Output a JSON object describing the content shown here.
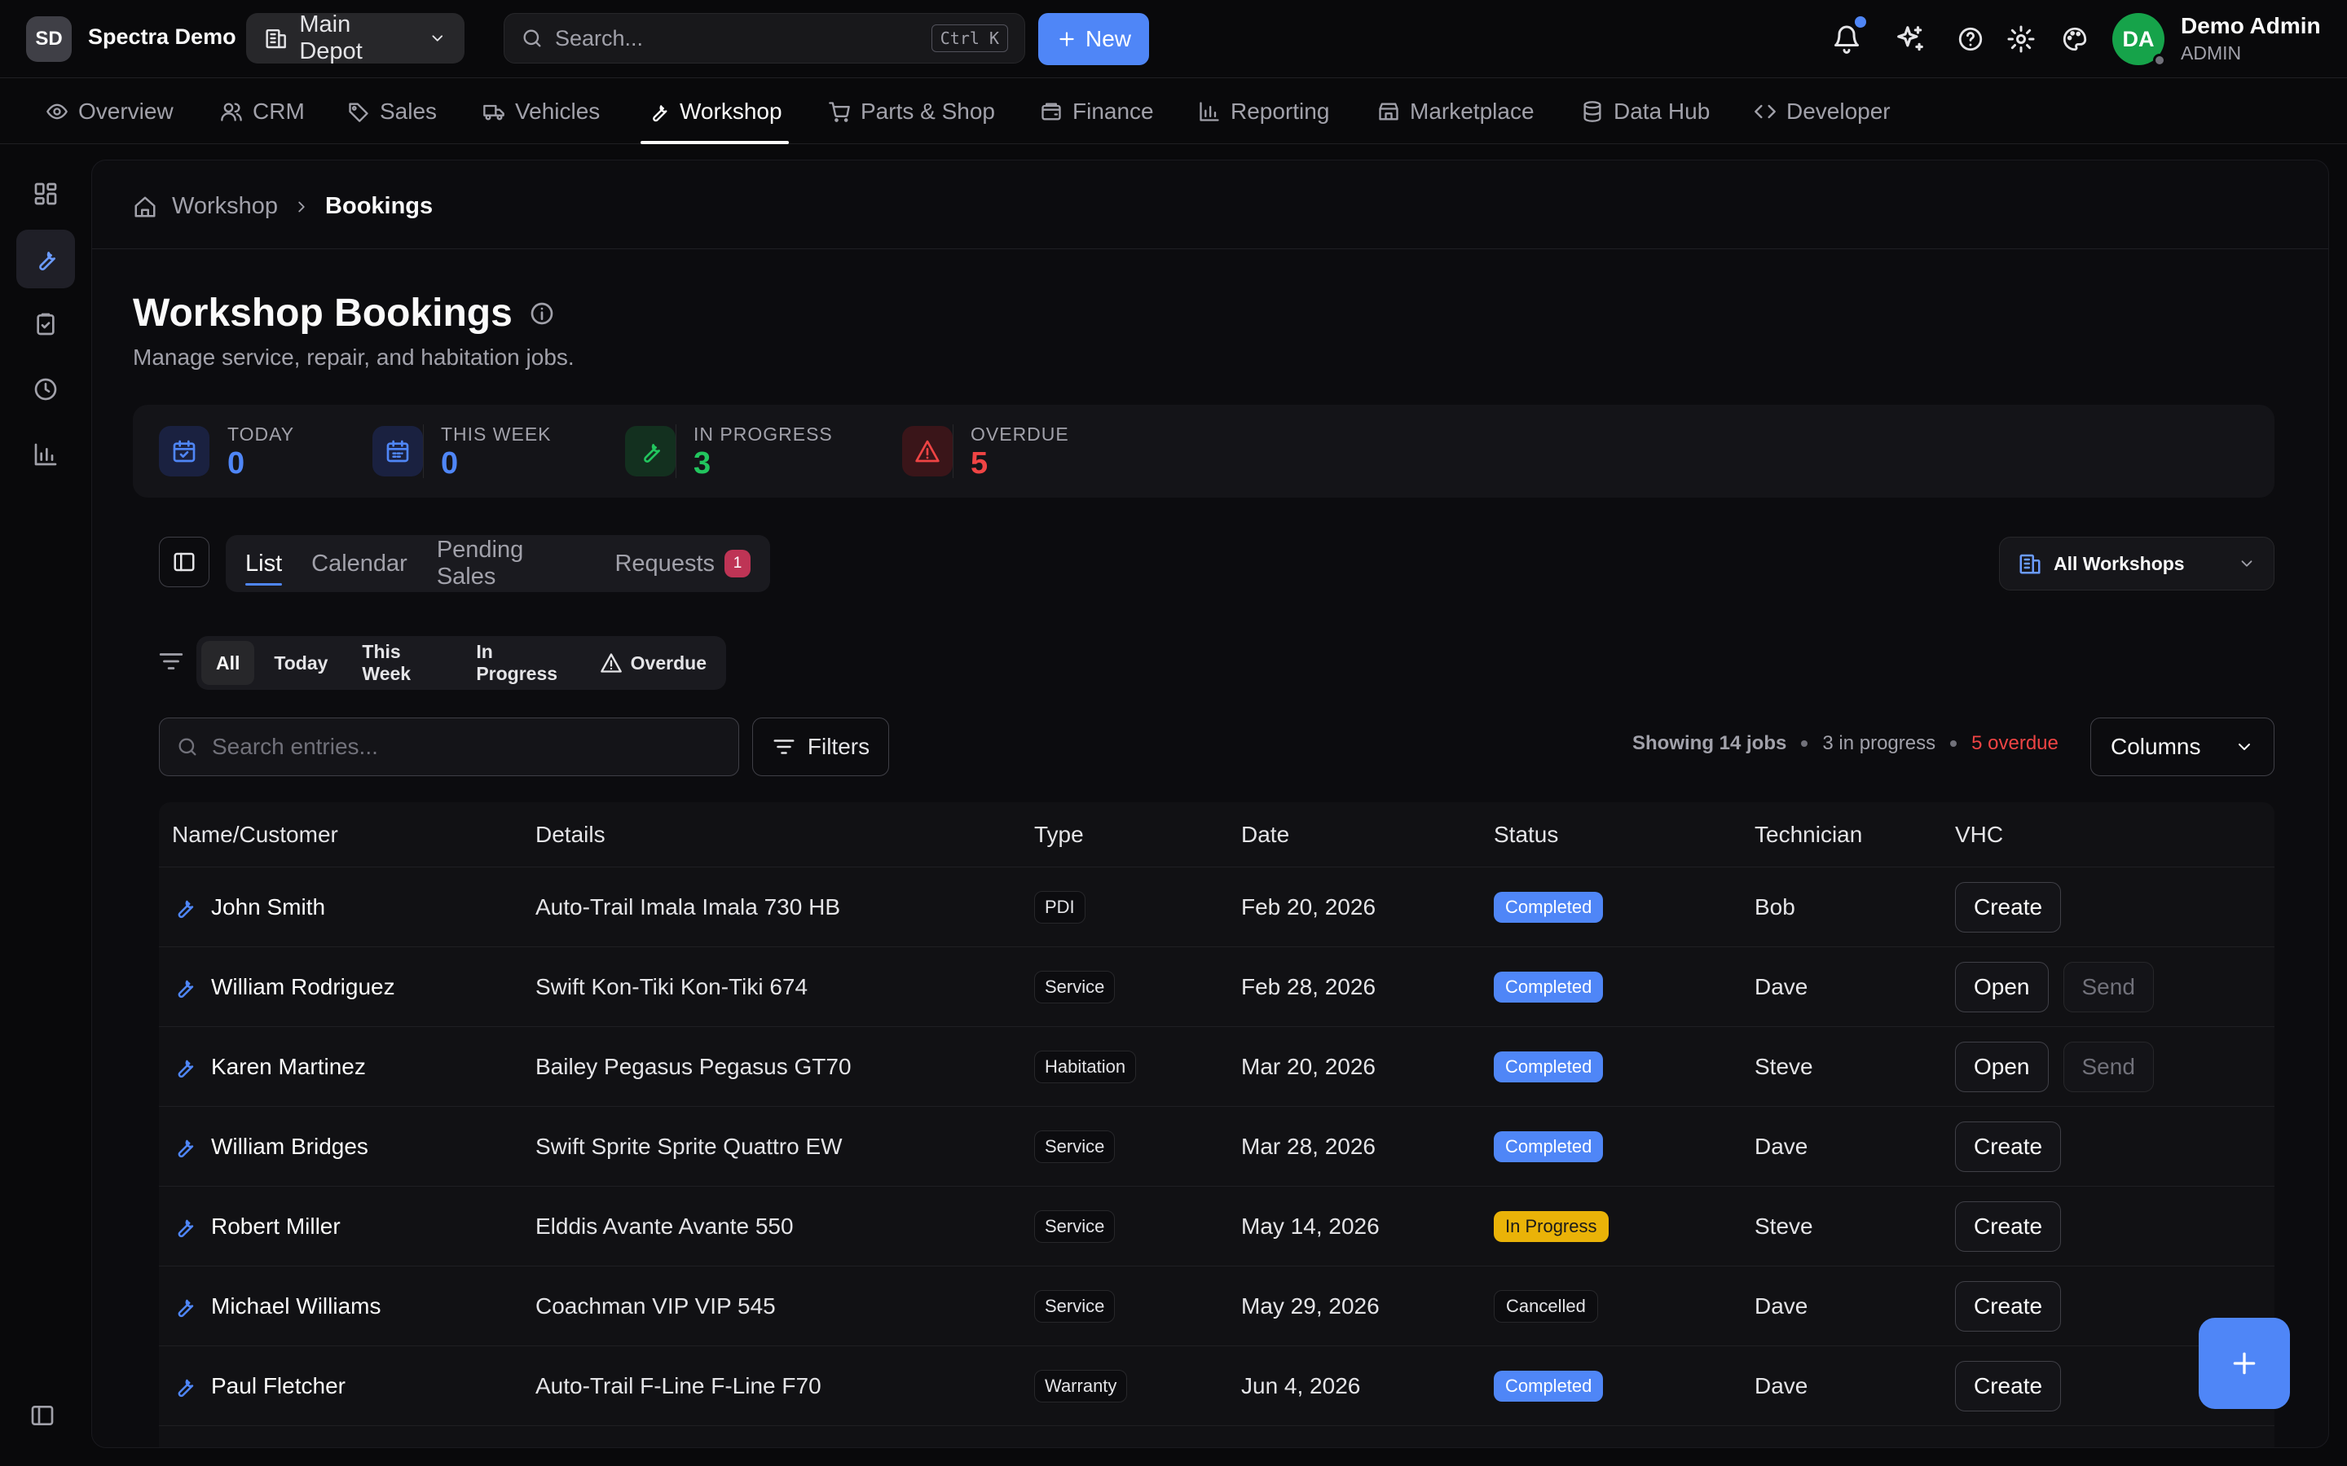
{
  "org": {
    "initials": "SD",
    "name": "Spectra Demo"
  },
  "depot": {
    "label": "Main Depot"
  },
  "global_search": {
    "placeholder": "Search...",
    "shortcut": "Ctrl K"
  },
  "new_button": {
    "label": "New"
  },
  "user": {
    "initials": "DA",
    "name": "Demo Admin",
    "role": "ADMIN"
  },
  "nav": {
    "items": [
      {
        "label": "Overview",
        "icon": "eye-icon"
      },
      {
        "label": "CRM",
        "icon": "users-icon"
      },
      {
        "label": "Sales",
        "icon": "tag-icon"
      },
      {
        "label": "Vehicles",
        "icon": "truck-icon"
      },
      {
        "label": "Workshop",
        "icon": "wrench-icon",
        "active": true
      },
      {
        "label": "Parts & Shop",
        "icon": "cart-icon"
      },
      {
        "label": "Finance",
        "icon": "wallet-icon"
      },
      {
        "label": "Reporting",
        "icon": "bar-chart-icon"
      },
      {
        "label": "Marketplace",
        "icon": "store-icon"
      },
      {
        "label": "Data Hub",
        "icon": "database-icon"
      },
      {
        "label": "Developer",
        "icon": "code-icon"
      }
    ]
  },
  "breadcrumb": {
    "parent": "Workshop",
    "current": "Bookings"
  },
  "page": {
    "title": "Workshop Bookings",
    "subtitle": "Manage service, repair, and habitation jobs."
  },
  "stats": [
    {
      "label": "TODAY",
      "value": "0",
      "color": "#4f86f7"
    },
    {
      "label": "THIS WEEK",
      "value": "0",
      "color": "#4f86f7"
    },
    {
      "label": "IN PROGRESS",
      "value": "3",
      "color": "#22c55e"
    },
    {
      "label": "OVERDUE",
      "value": "5",
      "color": "#ef4444"
    }
  ],
  "view_tabs": [
    {
      "label": "List",
      "active": true
    },
    {
      "label": "Calendar"
    },
    {
      "label": "Pending Sales"
    },
    {
      "label": "Requests",
      "badge": "1"
    }
  ],
  "workshop_select": {
    "label": "All Workshops"
  },
  "quick_filters": [
    {
      "label": "All",
      "active": true
    },
    {
      "label": "Today"
    },
    {
      "label": "This Week"
    },
    {
      "label": "In Progress"
    },
    {
      "label": "Overdue",
      "icon": "alert-triangle-icon"
    }
  ],
  "table_search": {
    "placeholder": "Search entries..."
  },
  "filters_button": {
    "label": "Filters"
  },
  "summary": {
    "showing": "Showing 14 jobs",
    "in_progress": "3 in progress",
    "overdue": "5 overdue"
  },
  "columns_button": {
    "label": "Columns"
  },
  "table": {
    "headers": [
      "Name/Customer",
      "Details",
      "Type",
      "Date",
      "Status",
      "Technician",
      "VHC"
    ],
    "rows": [
      {
        "name": "John Smith",
        "details": "Auto-Trail Imala Imala 730 HB",
        "type": "PDI",
        "date": "Feb 20, 2026",
        "status": "Completed",
        "technician": "Bob",
        "vhc": [
          "Create"
        ]
      },
      {
        "name": "William Rodriguez",
        "details": "Swift Kon-Tiki Kon-Tiki 674",
        "type": "Service",
        "date": "Feb 28, 2026",
        "status": "Completed",
        "technician": "Dave",
        "vhc": [
          "Open",
          "Send"
        ]
      },
      {
        "name": "Karen Martinez",
        "details": "Bailey Pegasus Pegasus GT70",
        "type": "Habitation",
        "date": "Mar 20, 2026",
        "status": "Completed",
        "technician": "Steve",
        "vhc": [
          "Open",
          "Send"
        ]
      },
      {
        "name": "William Bridges",
        "details": "Swift Sprite Sprite Quattro EW",
        "type": "Service",
        "date": "Mar 28, 2026",
        "status": "Completed",
        "technician": "Dave",
        "vhc": [
          "Create"
        ]
      },
      {
        "name": "Robert Miller",
        "details": "Elddis Avante Avante 550",
        "type": "Service",
        "date": "May 14, 2026",
        "status": "In Progress",
        "technician": "Steve",
        "vhc": [
          "Create"
        ]
      },
      {
        "name": "Michael Williams",
        "details": "Coachman VIP VIP 545",
        "type": "Service",
        "date": "May 29, 2026",
        "status": "Cancelled",
        "technician": "Dave",
        "vhc": [
          "Create"
        ]
      },
      {
        "name": "Paul Fletcher",
        "details": "Auto-Trail F-Line F-Line F70",
        "type": "Warranty",
        "date": "Jun 4, 2026",
        "status": "Completed",
        "technician": "Dave",
        "vhc": [
          "Create"
        ]
      }
    ]
  }
}
